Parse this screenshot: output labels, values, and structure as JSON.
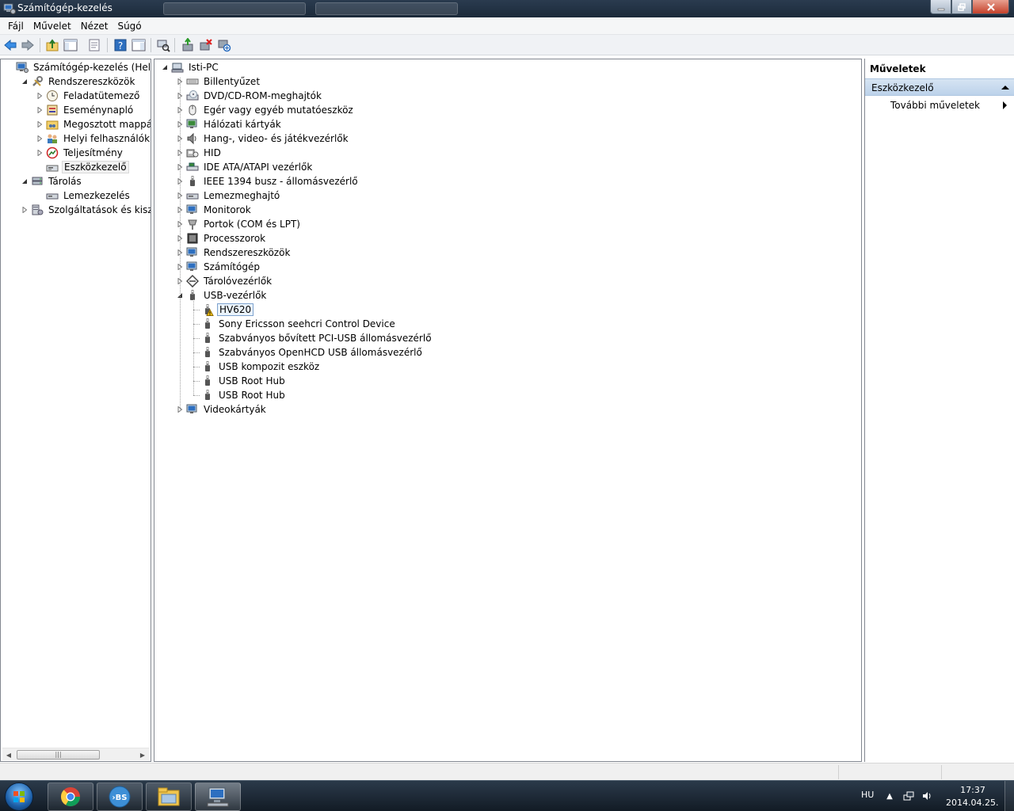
{
  "window": {
    "title": "Számítógép-kezelés"
  },
  "menu": [
    "Fájl",
    "Művelet",
    "Nézet",
    "Súgó"
  ],
  "left_tree": [
    {
      "label": "Számítógép-kezelés (Helyi)",
      "level": 0,
      "expander": "none",
      "icon": "computer-management-icon"
    },
    {
      "label": "Rendszereszközök",
      "level": 1,
      "expander": "expanded",
      "icon": "tools-icon"
    },
    {
      "label": "Feladatütemező",
      "level": 2,
      "expander": "collapsed",
      "icon": "clock-icon"
    },
    {
      "label": "Eseménynapló",
      "level": 2,
      "expander": "collapsed",
      "icon": "event-viewer-icon"
    },
    {
      "label": "Megosztott mappák",
      "level": 2,
      "expander": "collapsed",
      "icon": "shared-folder-icon"
    },
    {
      "label": "Helyi felhasználók és cs",
      "level": 2,
      "expander": "collapsed",
      "icon": "users-icon"
    },
    {
      "label": "Teljesítmény",
      "level": 2,
      "expander": "collapsed",
      "icon": "performance-icon"
    },
    {
      "label": "Eszközkezelő",
      "level": 2,
      "expander": "none",
      "icon": "device-manager-icon",
      "selected": true
    },
    {
      "label": "Tárolás",
      "level": 1,
      "expander": "expanded",
      "icon": "storage-icon"
    },
    {
      "label": "Lemezkezelés",
      "level": 2,
      "expander": "none",
      "icon": "disk-management-icon"
    },
    {
      "label": "Szolgáltatások és kiszolgáló",
      "level": 1,
      "expander": "collapsed",
      "icon": "services-icon"
    }
  ],
  "device_tree": {
    "root": "Isti-PC",
    "categories": [
      {
        "label": "Billentyűzet",
        "icon": "keyboard-icon"
      },
      {
        "label": "DVD/CD-ROM-meghajtók",
        "icon": "dvd-drive-icon"
      },
      {
        "label": "Egér vagy egyéb mutatóeszköz",
        "icon": "mouse-icon"
      },
      {
        "label": "Hálózati kártyák",
        "icon": "network-card-icon"
      },
      {
        "label": "Hang-, video- és játékvezérlők",
        "icon": "sound-icon"
      },
      {
        "label": "HID",
        "icon": "hid-icon"
      },
      {
        "label": "IDE ATA/ATAPI vezérlők",
        "icon": "ide-controller-icon"
      },
      {
        "label": "IEEE 1394 busz - állomásvezérlő",
        "icon": "firewire-icon"
      },
      {
        "label": "Lemezmeghajtó",
        "icon": "disk-drive-icon"
      },
      {
        "label": "Monitorok",
        "icon": "monitor-icon"
      },
      {
        "label": "Portok (COM és LPT)",
        "icon": "port-icon"
      },
      {
        "label": "Processzorok",
        "icon": "processor-icon"
      },
      {
        "label": "Rendszereszközök",
        "icon": "system-devices-icon"
      },
      {
        "label": "Számítógép",
        "icon": "computer-icon"
      },
      {
        "label": "Tárolóvezérlők",
        "icon": "storage-controller-icon"
      },
      {
        "label": "USB-vezérlők",
        "icon": "usb-icon",
        "expanded": true,
        "children": [
          {
            "label": "HV620",
            "icon": "usb-warning-icon",
            "focused": true
          },
          {
            "label": "Sony Ericsson seehcri Control Device",
            "icon": "usb-device-icon"
          },
          {
            "label": "Szabványos bővített PCI-USB állomásvezérlő",
            "icon": "usb-device-icon"
          },
          {
            "label": "Szabványos OpenHCD USB állomásvezérlő",
            "icon": "usb-device-icon"
          },
          {
            "label": "USB kompozit eszköz",
            "icon": "usb-device-icon"
          },
          {
            "label": "USB Root Hub",
            "icon": "usb-device-icon"
          },
          {
            "label": "USB Root Hub",
            "icon": "usb-device-icon"
          }
        ]
      },
      {
        "label": "Videokártyák",
        "icon": "video-card-icon"
      }
    ]
  },
  "actions": {
    "title": "Műveletek",
    "section": "Eszközkezelő",
    "more": "További műveletek"
  },
  "taskbar": {
    "lang": "HU",
    "time": "17:37",
    "date": "2014.04.25."
  },
  "colors": {
    "titlebar": "#1c2a3a",
    "selection": "#eaf3fc",
    "actions_header": "#bcd2ea"
  }
}
